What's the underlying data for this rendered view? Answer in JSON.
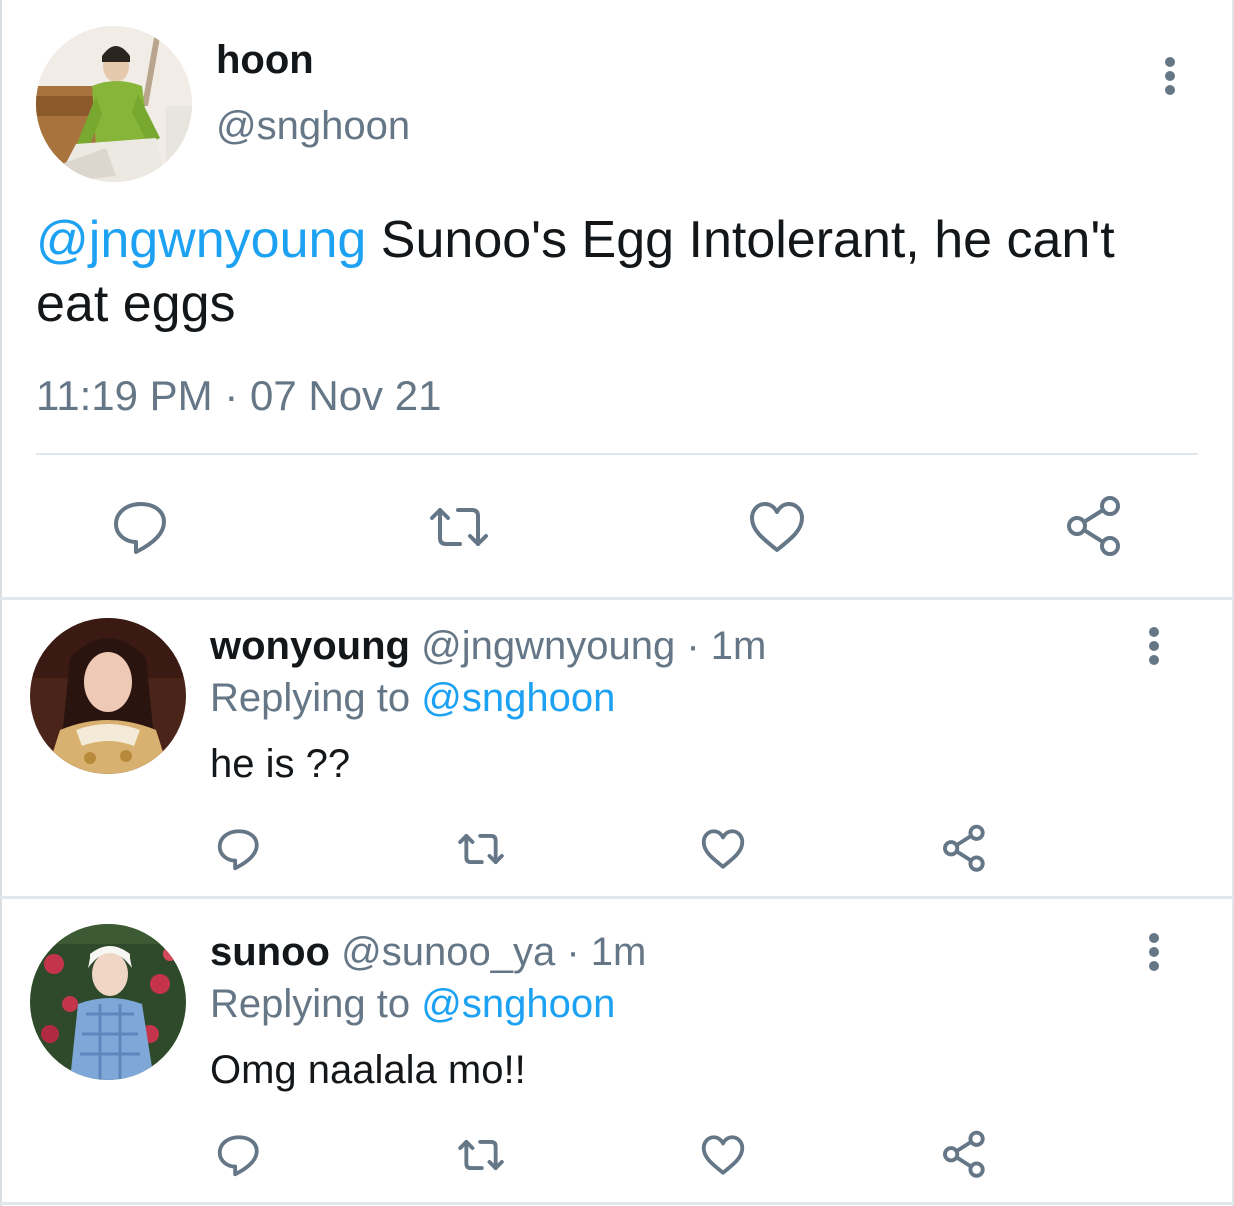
{
  "main_tweet": {
    "name": "hoon",
    "handle": "@snghoon",
    "mention": "@jngwnyoung",
    "text": " Sunoo's Egg Intolerant, he can't eat eggs",
    "time": "11:19 PM · 07 Nov 21",
    "actions": [
      "reply-icon",
      "retweet-icon",
      "like-icon",
      "share-icon"
    ]
  },
  "replies": [
    {
      "name": "wonyoung",
      "handle": "@jngwnyoung",
      "time": " · 1m",
      "replying_label": "Replying to ",
      "replying_to": "@snghoon",
      "text": "he is ??"
    },
    {
      "name": "sunoo",
      "handle": "@sunoo_ya",
      "time": " · 1m",
      "replying_label": "Replying to ",
      "replying_to": "@snghoon",
      "text": "Omg naalala mo!!"
    }
  ],
  "colors": {
    "accent": "#1da1f2",
    "secondary_text": "#657786",
    "primary_text": "#14171a",
    "divider": "#e1e8ed"
  }
}
